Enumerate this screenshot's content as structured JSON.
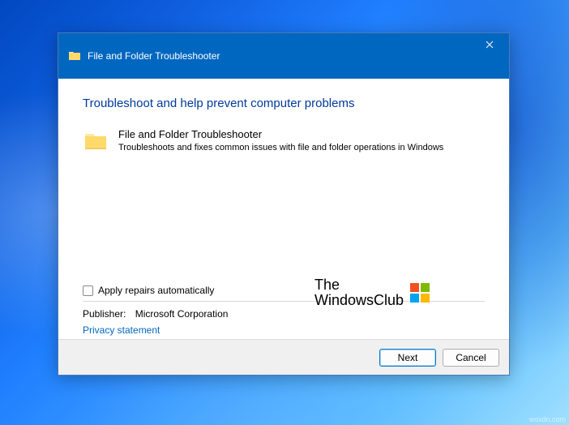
{
  "titlebar": {
    "title": "File and Folder Troubleshooter"
  },
  "content": {
    "heading": "Troubleshoot and help prevent computer problems",
    "item": {
      "title": "File and Folder Troubleshooter",
      "description": "Troubleshoots and fixes common issues with file and folder operations in Windows"
    },
    "checkbox_label": "Apply repairs automatically",
    "publisher_label": "Publisher:",
    "publisher_value": "Microsoft Corporation",
    "privacy_link": "Privacy statement"
  },
  "watermark": {
    "line1": "The",
    "line2": "WindowsClub"
  },
  "footer": {
    "next": "Next",
    "cancel": "Cancel"
  },
  "attribution": "wsxdn.com"
}
